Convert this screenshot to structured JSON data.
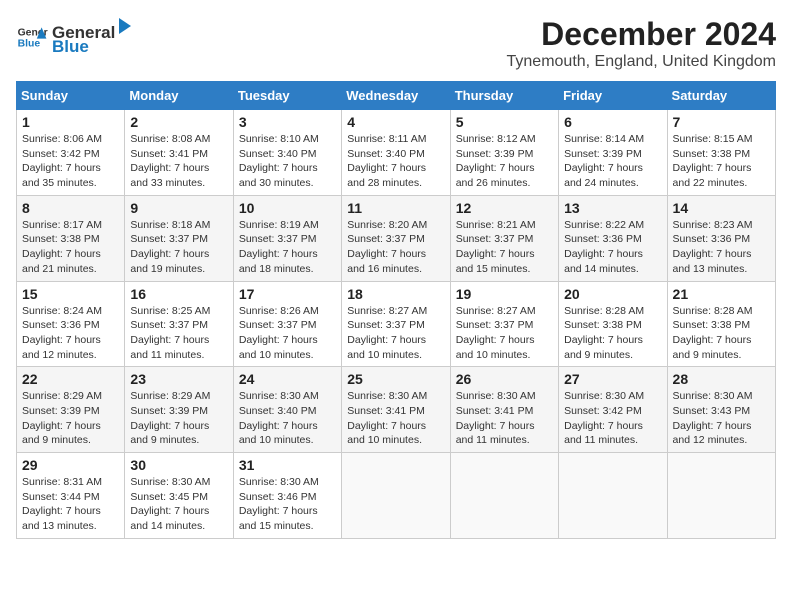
{
  "header": {
    "logo_general": "General",
    "logo_blue": "Blue",
    "month_title": "December 2024",
    "location": "Tynemouth, England, United Kingdom"
  },
  "weekdays": [
    "Sunday",
    "Monday",
    "Tuesday",
    "Wednesday",
    "Thursday",
    "Friday",
    "Saturday"
  ],
  "weeks": [
    [
      {
        "day": "1",
        "sunrise": "8:06 AM",
        "sunset": "3:42 PM",
        "daylight": "7 hours and 35 minutes."
      },
      {
        "day": "2",
        "sunrise": "8:08 AM",
        "sunset": "3:41 PM",
        "daylight": "7 hours and 33 minutes."
      },
      {
        "day": "3",
        "sunrise": "8:10 AM",
        "sunset": "3:40 PM",
        "daylight": "7 hours and 30 minutes."
      },
      {
        "day": "4",
        "sunrise": "8:11 AM",
        "sunset": "3:40 PM",
        "daylight": "7 hours and 28 minutes."
      },
      {
        "day": "5",
        "sunrise": "8:12 AM",
        "sunset": "3:39 PM",
        "daylight": "7 hours and 26 minutes."
      },
      {
        "day": "6",
        "sunrise": "8:14 AM",
        "sunset": "3:39 PM",
        "daylight": "7 hours and 24 minutes."
      },
      {
        "day": "7",
        "sunrise": "8:15 AM",
        "sunset": "3:38 PM",
        "daylight": "7 hours and 22 minutes."
      }
    ],
    [
      {
        "day": "8",
        "sunrise": "8:17 AM",
        "sunset": "3:38 PM",
        "daylight": "7 hours and 21 minutes."
      },
      {
        "day": "9",
        "sunrise": "8:18 AM",
        "sunset": "3:37 PM",
        "daylight": "7 hours and 19 minutes."
      },
      {
        "day": "10",
        "sunrise": "8:19 AM",
        "sunset": "3:37 PM",
        "daylight": "7 hours and 18 minutes."
      },
      {
        "day": "11",
        "sunrise": "8:20 AM",
        "sunset": "3:37 PM",
        "daylight": "7 hours and 16 minutes."
      },
      {
        "day": "12",
        "sunrise": "8:21 AM",
        "sunset": "3:37 PM",
        "daylight": "7 hours and 15 minutes."
      },
      {
        "day": "13",
        "sunrise": "8:22 AM",
        "sunset": "3:36 PM",
        "daylight": "7 hours and 14 minutes."
      },
      {
        "day": "14",
        "sunrise": "8:23 AM",
        "sunset": "3:36 PM",
        "daylight": "7 hours and 13 minutes."
      }
    ],
    [
      {
        "day": "15",
        "sunrise": "8:24 AM",
        "sunset": "3:36 PM",
        "daylight": "7 hours and 12 minutes."
      },
      {
        "day": "16",
        "sunrise": "8:25 AM",
        "sunset": "3:37 PM",
        "daylight": "7 hours and 11 minutes."
      },
      {
        "day": "17",
        "sunrise": "8:26 AM",
        "sunset": "3:37 PM",
        "daylight": "7 hours and 10 minutes."
      },
      {
        "day": "18",
        "sunrise": "8:27 AM",
        "sunset": "3:37 PM",
        "daylight": "7 hours and 10 minutes."
      },
      {
        "day": "19",
        "sunrise": "8:27 AM",
        "sunset": "3:37 PM",
        "daylight": "7 hours and 10 minutes."
      },
      {
        "day": "20",
        "sunrise": "8:28 AM",
        "sunset": "3:38 PM",
        "daylight": "7 hours and 9 minutes."
      },
      {
        "day": "21",
        "sunrise": "8:28 AM",
        "sunset": "3:38 PM",
        "daylight": "7 hours and 9 minutes."
      }
    ],
    [
      {
        "day": "22",
        "sunrise": "8:29 AM",
        "sunset": "3:39 PM",
        "daylight": "7 hours and 9 minutes."
      },
      {
        "day": "23",
        "sunrise": "8:29 AM",
        "sunset": "3:39 PM",
        "daylight": "7 hours and 9 minutes."
      },
      {
        "day": "24",
        "sunrise": "8:30 AM",
        "sunset": "3:40 PM",
        "daylight": "7 hours and 10 minutes."
      },
      {
        "day": "25",
        "sunrise": "8:30 AM",
        "sunset": "3:41 PM",
        "daylight": "7 hours and 10 minutes."
      },
      {
        "day": "26",
        "sunrise": "8:30 AM",
        "sunset": "3:41 PM",
        "daylight": "7 hours and 11 minutes."
      },
      {
        "day": "27",
        "sunrise": "8:30 AM",
        "sunset": "3:42 PM",
        "daylight": "7 hours and 11 minutes."
      },
      {
        "day": "28",
        "sunrise": "8:30 AM",
        "sunset": "3:43 PM",
        "daylight": "7 hours and 12 minutes."
      }
    ],
    [
      {
        "day": "29",
        "sunrise": "8:31 AM",
        "sunset": "3:44 PM",
        "daylight": "7 hours and 13 minutes."
      },
      {
        "day": "30",
        "sunrise": "8:30 AM",
        "sunset": "3:45 PM",
        "daylight": "7 hours and 14 minutes."
      },
      {
        "day": "31",
        "sunrise": "8:30 AM",
        "sunset": "3:46 PM",
        "daylight": "7 hours and 15 minutes."
      },
      null,
      null,
      null,
      null
    ]
  ]
}
